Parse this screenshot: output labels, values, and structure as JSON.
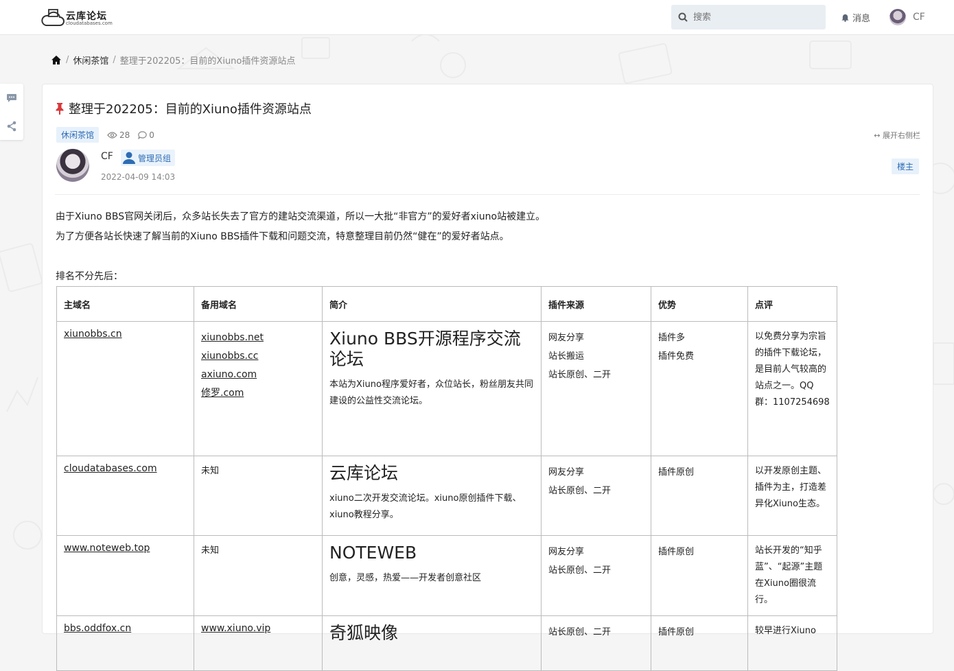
{
  "header": {
    "logo_name": "云库论坛",
    "logo_sub": "cloudatabases.com",
    "search_placeholder": "搜索",
    "messages_label": "消息",
    "username": "CF"
  },
  "breadcrumb": {
    "forum": "休闲茶馆",
    "current": "整理于202205：目前的Xiuno插件资源站点"
  },
  "thread": {
    "title": "整理于202205：目前的Xiuno插件资源站点",
    "forum_tag": "休闲茶馆",
    "views": "28",
    "replies": "0",
    "expand_label": "展开右侧栏",
    "author": "CF",
    "role": "管理员组",
    "date": "2022-04-09 14:03",
    "owner_tag": "楼主",
    "para1": "由于Xiuno BBS官网关闭后，众多站长失去了官方的建站交流渠道，所以一大批“非官方”的爱好者xiuno站被建立。",
    "para2": "为了方便各站长快速了解当前的Xiuno BBS插件下载和问题交流，特意整理目前仍然“健在”的爱好者站点。",
    "para3": "排名不分先后："
  },
  "table": {
    "headers": [
      "主域名",
      "备用域名",
      "简介",
      "插件来源",
      "优势",
      "点评"
    ],
    "rows": [
      {
        "main": "xiunobbs.cn",
        "alt": [
          "xiunobbs.net",
          "xiunobbs.cc",
          "axiuno.com",
          "修罗.com"
        ],
        "intro_title": "Xiuno BBS开源程序交流论坛",
        "intro_desc": "本站为Xiuno程序爱好者，众位站长，粉丝朋友共同建设的公益性交流论坛。",
        "source": [
          "网友分享",
          "站长搬运",
          "站长原创、二开"
        ],
        "adv": [
          "插件多",
          "插件免费"
        ],
        "review": "以免费分享为宗旨的插件下载论坛，是目前人气较高的站点之一。QQ群：1107254698"
      },
      {
        "main": "cloudatabases.com",
        "alt": [
          "未知"
        ],
        "intro_title": "云库论坛",
        "intro_desc": "xiuno二次开发交流论坛。xiuno原创插件下载、xiuno教程分享。",
        "source": [
          "网友分享",
          "站长原创、二开"
        ],
        "adv": [
          "插件原创"
        ],
        "review": "以开发原创主题、插件为主，打造差异化Xiuno生态。"
      },
      {
        "main": "www.noteweb.top",
        "alt": [
          "未知"
        ],
        "intro_title": "NOTEWEB",
        "intro_desc": "创意，灵感，热爱——开发者创意社区",
        "source": [
          "网友分享",
          "站长原创、二开"
        ],
        "adv": [
          "插件原创"
        ],
        "review": "站长开发的“知乎蓝”、“起源”主题在Xiuno圈很流行。"
      },
      {
        "main": "bbs.oddfox.cn",
        "alt": [
          "www.xiuno.vip"
        ],
        "intro_title": "奇狐映像",
        "intro_desc": "",
        "source": [
          "站长原创、二开"
        ],
        "adv": [
          "插件原创"
        ],
        "review": "较早进行Xiuno"
      }
    ]
  }
}
